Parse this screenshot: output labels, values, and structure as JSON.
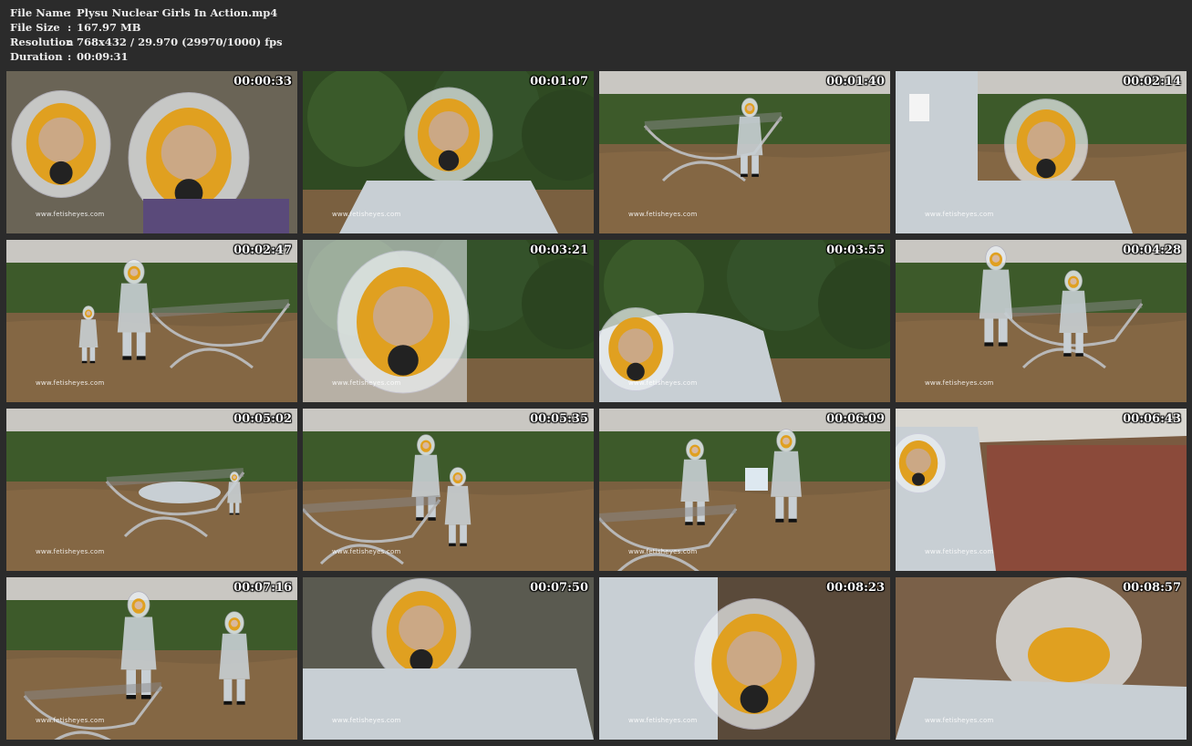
{
  "meta": {
    "file_name": {
      "label": "File Name",
      "sep": ":",
      "value": "Plysu Nuclear Girls In Action.mp4"
    },
    "file_size": {
      "label": "File Size",
      "sep": ":",
      "value": "167.97 MB"
    },
    "resolution": {
      "label": "Resolution",
      "sep": ":",
      "value": "768x432 / 29.970 (29970/1000) fps"
    },
    "duration": {
      "label": "Duration",
      "sep": ":",
      "value": "00:09:31"
    }
  },
  "watermark": "www.fetisheyes.com",
  "colors": {
    "background": "#2b2b2b",
    "text": "#ececec",
    "suit": "#c8cfd4",
    "mask": "#e0a020",
    "foliage": "#3d5a2a",
    "ground": "#7a6040"
  },
  "thumbnails": [
    {
      "timestamp": "00:00:33",
      "scene": "closeup-two-masks"
    },
    {
      "timestamp": "00:01:07",
      "scene": "closeup-hood-garden"
    },
    {
      "timestamp": "00:01:40",
      "scene": "lounger-sitting"
    },
    {
      "timestamp": "00:02:14",
      "scene": "hood-closeup-bottle"
    },
    {
      "timestamp": "00:02:47",
      "scene": "garden-walking"
    },
    {
      "timestamp": "00:03:21",
      "scene": "mask-extreme-closeup"
    },
    {
      "timestamp": "00:03:55",
      "scene": "hedge-leaning"
    },
    {
      "timestamp": "00:04:28",
      "scene": "garden-two-standing"
    },
    {
      "timestamp": "00:05:02",
      "scene": "lounger-lying"
    },
    {
      "timestamp": "00:05:35",
      "scene": "garden-bending"
    },
    {
      "timestamp": "00:06:09",
      "scene": "garden-two-towel"
    },
    {
      "timestamp": "00:06:43",
      "scene": "blurred-motion"
    },
    {
      "timestamp": "00:07:16",
      "scene": "garden-two-waving"
    },
    {
      "timestamp": "00:07:50",
      "scene": "hood-motion-blur"
    },
    {
      "timestamp": "00:08:23",
      "scene": "mask-tilted-closeup"
    },
    {
      "timestamp": "00:08:57",
      "scene": "hood-top-closeup"
    }
  ]
}
